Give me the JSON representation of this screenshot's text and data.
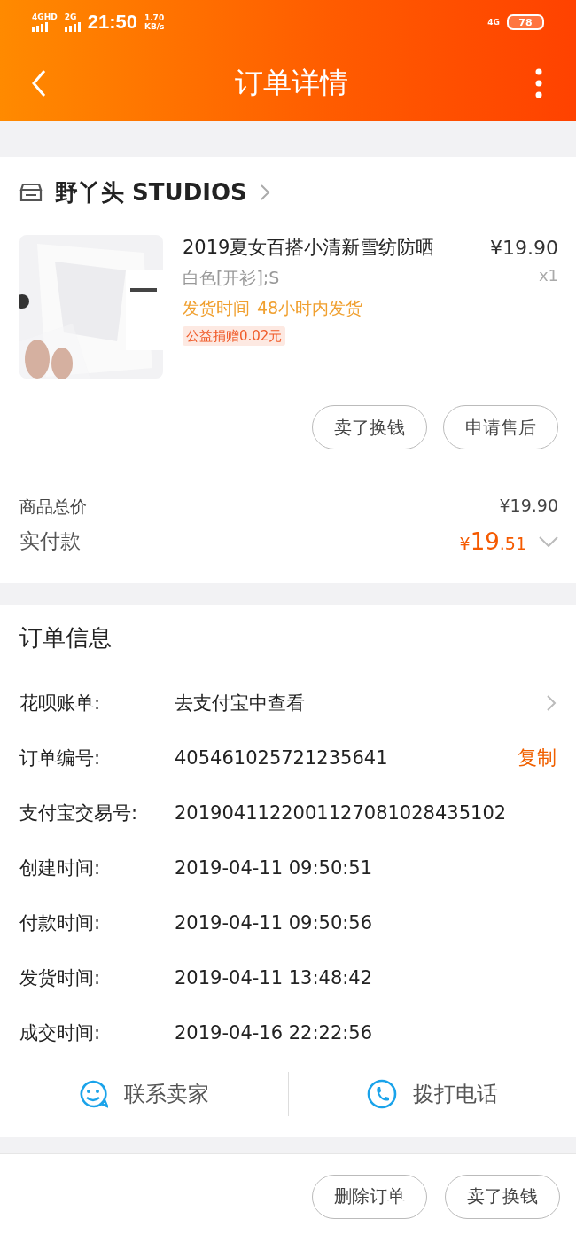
{
  "status_bar": {
    "network_1": "4G",
    "network_1_suffix": "HD",
    "network_2": "2G",
    "time": "21:50",
    "speed_value": "1.70",
    "speed_unit": "KB/s",
    "network_3": "4G",
    "battery": "78"
  },
  "header": {
    "title": "订单详情"
  },
  "shop": {
    "name": "野丫头 STUDIOS",
    "product": {
      "kind": "picture",
      "title": "2019夏女百搭小清新雪纺防晒",
      "price": "¥19.90",
      "variant": "白色[开衫];S",
      "quantity": "x1",
      "shipping_label": "发货时间",
      "shipping_value": "48小时内发货",
      "tag": "公益捐赠0.02元"
    },
    "buttons": [
      "卖了换钱",
      "申请售后"
    ],
    "total_label": "商品总价",
    "total_value": "¥19.90",
    "paid_label": "实付款",
    "paid_currency": "¥",
    "paid_integer": "19",
    "paid_decimal": ".51"
  },
  "order_info": {
    "title": "订单信息",
    "rows": [
      {
        "kind": "link",
        "label": "花呗账单:",
        "value": "去支付宝中查看"
      },
      {
        "kind": "copy",
        "label": "订单编号:",
        "value": "405461025721235641",
        "action": "复制"
      },
      {
        "kind": "plain",
        "label": "支付宝交易号:",
        "value": "2019041122001127081028435102"
      },
      {
        "kind": "plain",
        "label": "创建时间:",
        "value": "2019-04-11 09:50:51"
      },
      {
        "kind": "plain",
        "label": "付款时间:",
        "value": "2019-04-11 09:50:56"
      },
      {
        "kind": "plain",
        "label": "发货时间:",
        "value": "2019-04-11 13:48:42"
      },
      {
        "kind": "plain",
        "label": "成交时间:",
        "value": "2019-04-16 22:22:56"
      }
    ],
    "contacts": [
      {
        "kind": "chat",
        "label": "联系卖家"
      },
      {
        "kind": "phone",
        "label": "拨打电话"
      }
    ]
  },
  "bottom_bar": {
    "buttons": [
      "删除订单",
      "卖了换钱"
    ]
  }
}
